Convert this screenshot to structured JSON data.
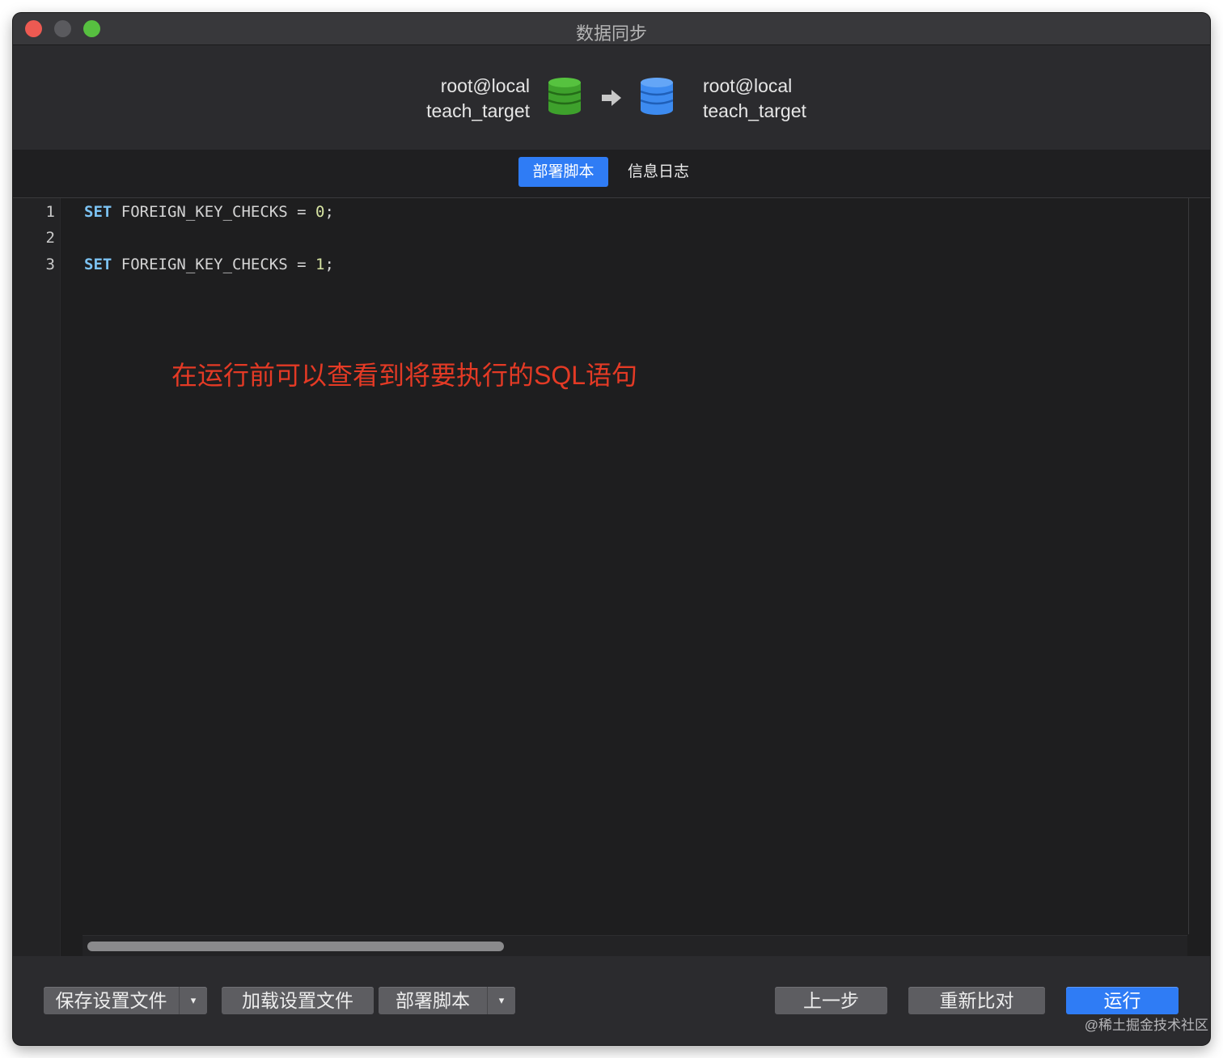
{
  "window": {
    "title": "数据同步"
  },
  "source": {
    "connection": "root@local",
    "database": "teach_target",
    "icon": "database-icon",
    "color": "#3ea12c"
  },
  "target": {
    "connection": "root@local",
    "database": "teach_target",
    "icon": "database-icon",
    "color": "#3d8bf0"
  },
  "arrow_icon": "arrow-right-icon",
  "tabs": [
    {
      "label": "部署脚本",
      "active": true
    },
    {
      "label": "信息日志",
      "active": false
    }
  ],
  "editor": {
    "lines": [
      {
        "number": "1",
        "keyword": "SET",
        "rest": " FOREIGN_KEY_CHECKS = ",
        "value": "0",
        "end": ";"
      },
      {
        "number": "2",
        "keyword": "",
        "rest": "",
        "value": "",
        "end": ""
      },
      {
        "number": "3",
        "keyword": "SET",
        "rest": " FOREIGN_KEY_CHECKS = ",
        "value": "1",
        "end": ";"
      }
    ],
    "annotation": "在运行前可以查看到将要执行的SQL语句"
  },
  "footer": {
    "save_profile": "保存设置文件",
    "load_profile": "加载设置文件",
    "deploy_script": "部署脚本",
    "caret": "▾",
    "prev": "上一步",
    "recompare": "重新比对",
    "run": "运行"
  },
  "watermark": "@稀土掘金技术社区",
  "colors": {
    "accent": "#2f7cf5",
    "annotation": "#e43a25"
  }
}
